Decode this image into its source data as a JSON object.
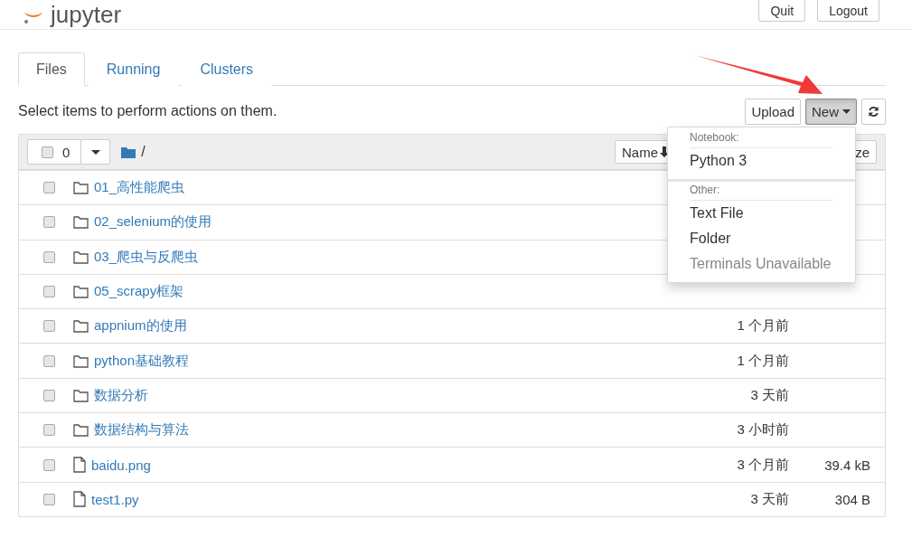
{
  "header": {
    "logo": "jupyter",
    "buttons": [
      "Quit",
      "Logout"
    ]
  },
  "tabs": [
    {
      "label": "Files",
      "selected": true
    },
    {
      "label": "Running",
      "selected": false
    },
    {
      "label": "Clusters",
      "selected": false
    }
  ],
  "toolbar": {
    "hint": "Select items to perform actions on them.",
    "upload": "Upload",
    "new": {
      "label": "New",
      "pressed": true
    }
  },
  "list_header": {
    "checked": false,
    "count": "0",
    "path": "/",
    "sort_buttons": [
      "Name",
      "ze"
    ]
  },
  "rows": [
    {
      "kind": "folder",
      "name": "01_高性能爬虫",
      "checked": false
    },
    {
      "kind": "folder",
      "name": "02_selenium的使用",
      "checked": false
    },
    {
      "kind": "folder",
      "name": "03_爬虫与反爬虫",
      "checked": false
    },
    {
      "kind": "folder",
      "name": "05_scrapy框架",
      "checked": false
    },
    {
      "kind": "folder",
      "name": "appnium的使用",
      "modified": "1 个月前",
      "checked": false
    },
    {
      "kind": "folder",
      "name": "python基础教程",
      "modified": "1 个月前",
      "checked": false
    },
    {
      "kind": "folder",
      "name": "数据分析",
      "modified": "3 天前",
      "checked": false
    },
    {
      "kind": "folder",
      "name": "数据结构与算法",
      "modified": "3 小时前",
      "checked": false
    },
    {
      "kind": "file",
      "name": "baidu.png",
      "modified": "3 个月前",
      "size": "39.4 kB",
      "checked": false
    },
    {
      "kind": "file",
      "name": "test1.py",
      "modified": "3 天前",
      "size": "304 B",
      "checked": false
    }
  ],
  "new_menu": {
    "sections": [
      {
        "heading": "Notebook:",
        "items": [
          {
            "label": "Python 3",
            "disabled": false
          }
        ]
      },
      {
        "heading": "Other:",
        "items": [
          {
            "label": "Text File",
            "disabled": false
          },
          {
            "label": "Folder",
            "disabled": false
          },
          {
            "label": "Terminals Unavailable",
            "disabled": true
          }
        ]
      }
    ]
  }
}
